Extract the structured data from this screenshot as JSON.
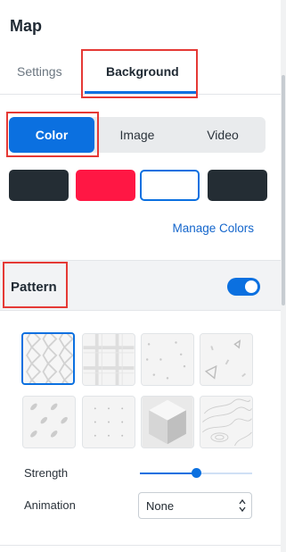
{
  "panel": {
    "title": "Map"
  },
  "tabs": [
    {
      "label": "Settings",
      "active": false
    },
    {
      "label": "Background",
      "active": true
    }
  ],
  "background_type": {
    "options": [
      "Color",
      "Image",
      "Video"
    ],
    "selected": "Color"
  },
  "swatches": [
    {
      "color": "#242d34",
      "selected": false
    },
    {
      "color": "#ff1744",
      "selected": false
    },
    {
      "color": "#ffffff",
      "selected": true
    },
    {
      "color": "#242d34",
      "selected": false
    }
  ],
  "manage_colors_label": "Manage Colors",
  "pattern": {
    "label": "Pattern",
    "enabled": true,
    "patterns": [
      {
        "name": "hexagon-chain",
        "selected": true
      },
      {
        "name": "plaid",
        "selected": false
      },
      {
        "name": "scattered-dots",
        "selected": false
      },
      {
        "name": "confetti-triangles",
        "selected": false
      },
      {
        "name": "diagonal-diamonds",
        "selected": false
      },
      {
        "name": "dot-grid",
        "selected": false
      },
      {
        "name": "isometric-cubes",
        "selected": false
      },
      {
        "name": "topographic",
        "selected": false
      }
    ]
  },
  "strength": {
    "label": "Strength",
    "value": 0.5
  },
  "animation": {
    "label": "Animation",
    "value": "None"
  },
  "colors": {
    "accent": "#0b70e0",
    "highlight": "#e53935"
  }
}
